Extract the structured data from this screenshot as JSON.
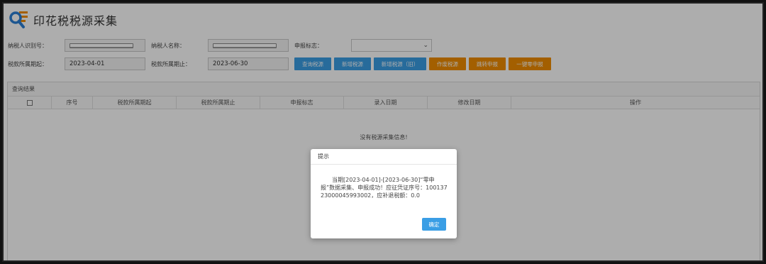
{
  "app": {
    "title": "印花税税源采集"
  },
  "form": {
    "taxpayer_id_label": "纳税人识别号：",
    "taxpayer_name_label": "纳税人名称：",
    "declare_flag_label": "申报标志：",
    "period_start_label": "税款所属期起：",
    "period_start_value": "2023-04-01",
    "period_end_label": "税款所属期止：",
    "period_end_value": "2023-06-30"
  },
  "toolbar": {
    "query": "查询税源",
    "add": "新增税源",
    "add_old": "新增税源（旧）",
    "void": "作废税源",
    "jump": "跳转申报",
    "zero": "一键零申报"
  },
  "results": {
    "title": "查询结果",
    "columns": [
      "序号",
      "税款所属期起",
      "税款所属期止",
      "申报标志",
      "录入日期",
      "修改日期",
      "操作"
    ],
    "empty_text": "没有税源采集信息!"
  },
  "dialog": {
    "title": "提示",
    "message": "当期[2023-04-01]-[2023-06-30]“零申报”数据采集、申报成功！应征凭证序号：10013723000045993002，应补退税额：0.0",
    "ok": "确定"
  },
  "colors": {
    "primary": "#3a9ee5",
    "warning": "#f08c00"
  }
}
